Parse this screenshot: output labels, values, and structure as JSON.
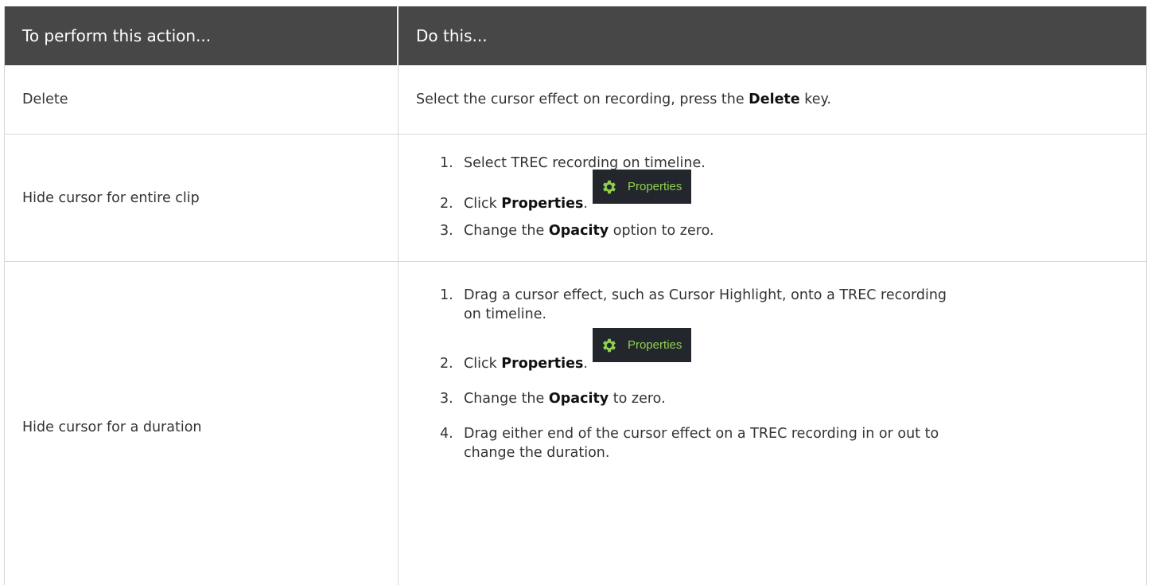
{
  "table": {
    "header": {
      "col1": "To perform this action...",
      "col2": "Do this..."
    },
    "rows": [
      {
        "action": "Delete",
        "instruction": {
          "pre": "Select the cursor effect on recording, press the ",
          "bold": "Delete",
          "post": " key."
        }
      },
      {
        "action": "Hide cursor for entire clip",
        "steps": [
          {
            "num": "1.",
            "text": "Select TREC recording on timeline."
          },
          {
            "num": "2.",
            "pre": "Click ",
            "bold": "Properties",
            "post": ".",
            "button_label": "Properties",
            "button_icon": "gear-icon"
          },
          {
            "num": "3.",
            "pre": "Change the ",
            "bold": "Opacity",
            "post": " option to zero."
          }
        ]
      },
      {
        "action": "Hide cursor for a duration",
        "steps": [
          {
            "num": "1.",
            "line1": "Drag a cursor effect, such as Cursor Highlight, onto a TREC recording",
            "line2": "on timeline."
          },
          {
            "num": "2.",
            "pre": "Click ",
            "bold": "Properties",
            "post": ".",
            "button_label": "Properties",
            "button_icon": "gear-icon"
          },
          {
            "num": "3.",
            "pre": "Change the ",
            "bold": "Opacity",
            "post": " to zero."
          },
          {
            "num": "4.",
            "line1": "Drag either end of the cursor effect on a TREC recording in or out to",
            "line2": "change the duration."
          }
        ]
      }
    ]
  },
  "colors": {
    "header_bg": "#474747",
    "header_text": "#ffffff",
    "border": "#d6d6d6",
    "button_bg": "#23272d",
    "button_text": "#8fd14f"
  }
}
